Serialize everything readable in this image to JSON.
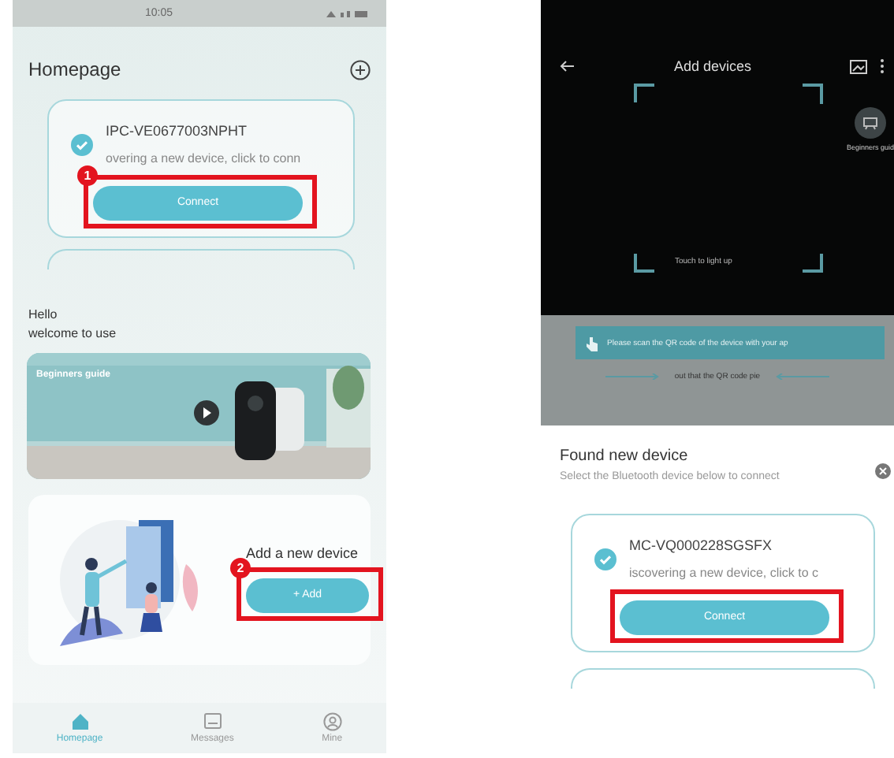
{
  "left_phone": {
    "status_bar": {
      "time": "10:05"
    },
    "title": "Homepage",
    "device_card": {
      "name": "IPC-VE0677003NPHT",
      "subtitle": "overing a new device, click to conn",
      "checked": true,
      "button": "Connect",
      "step": "1"
    },
    "greeting": [
      "Hello",
      "welcome to use"
    ],
    "banner": {
      "label": "Beginners guide"
    },
    "add_card": {
      "title": "Add a new device",
      "button": "+ Add",
      "step": "2"
    },
    "nav": [
      {
        "kind": "home",
        "label": "Homepage",
        "selected": true
      },
      {
        "kind": "messages",
        "label": "Messages",
        "selected": false
      },
      {
        "kind": "person",
        "label": "Mine",
        "selected": false
      }
    ]
  },
  "right_phone": {
    "title": "Add devices",
    "scan_hint": "Touch to light up",
    "guide_label": "Beginners guid",
    "tooltip": "Please scan the QR code of the device with your ap",
    "hint_line": "out that the QR code pie",
    "sheet": {
      "title": "Found new device",
      "subtitle": "Select the Bluetooth device below to connect"
    },
    "device_card": {
      "name": "MC-VQ000228SGSFX",
      "subtitle": "iscovering a new device, click to c",
      "checked": true,
      "button": "Connect"
    }
  }
}
